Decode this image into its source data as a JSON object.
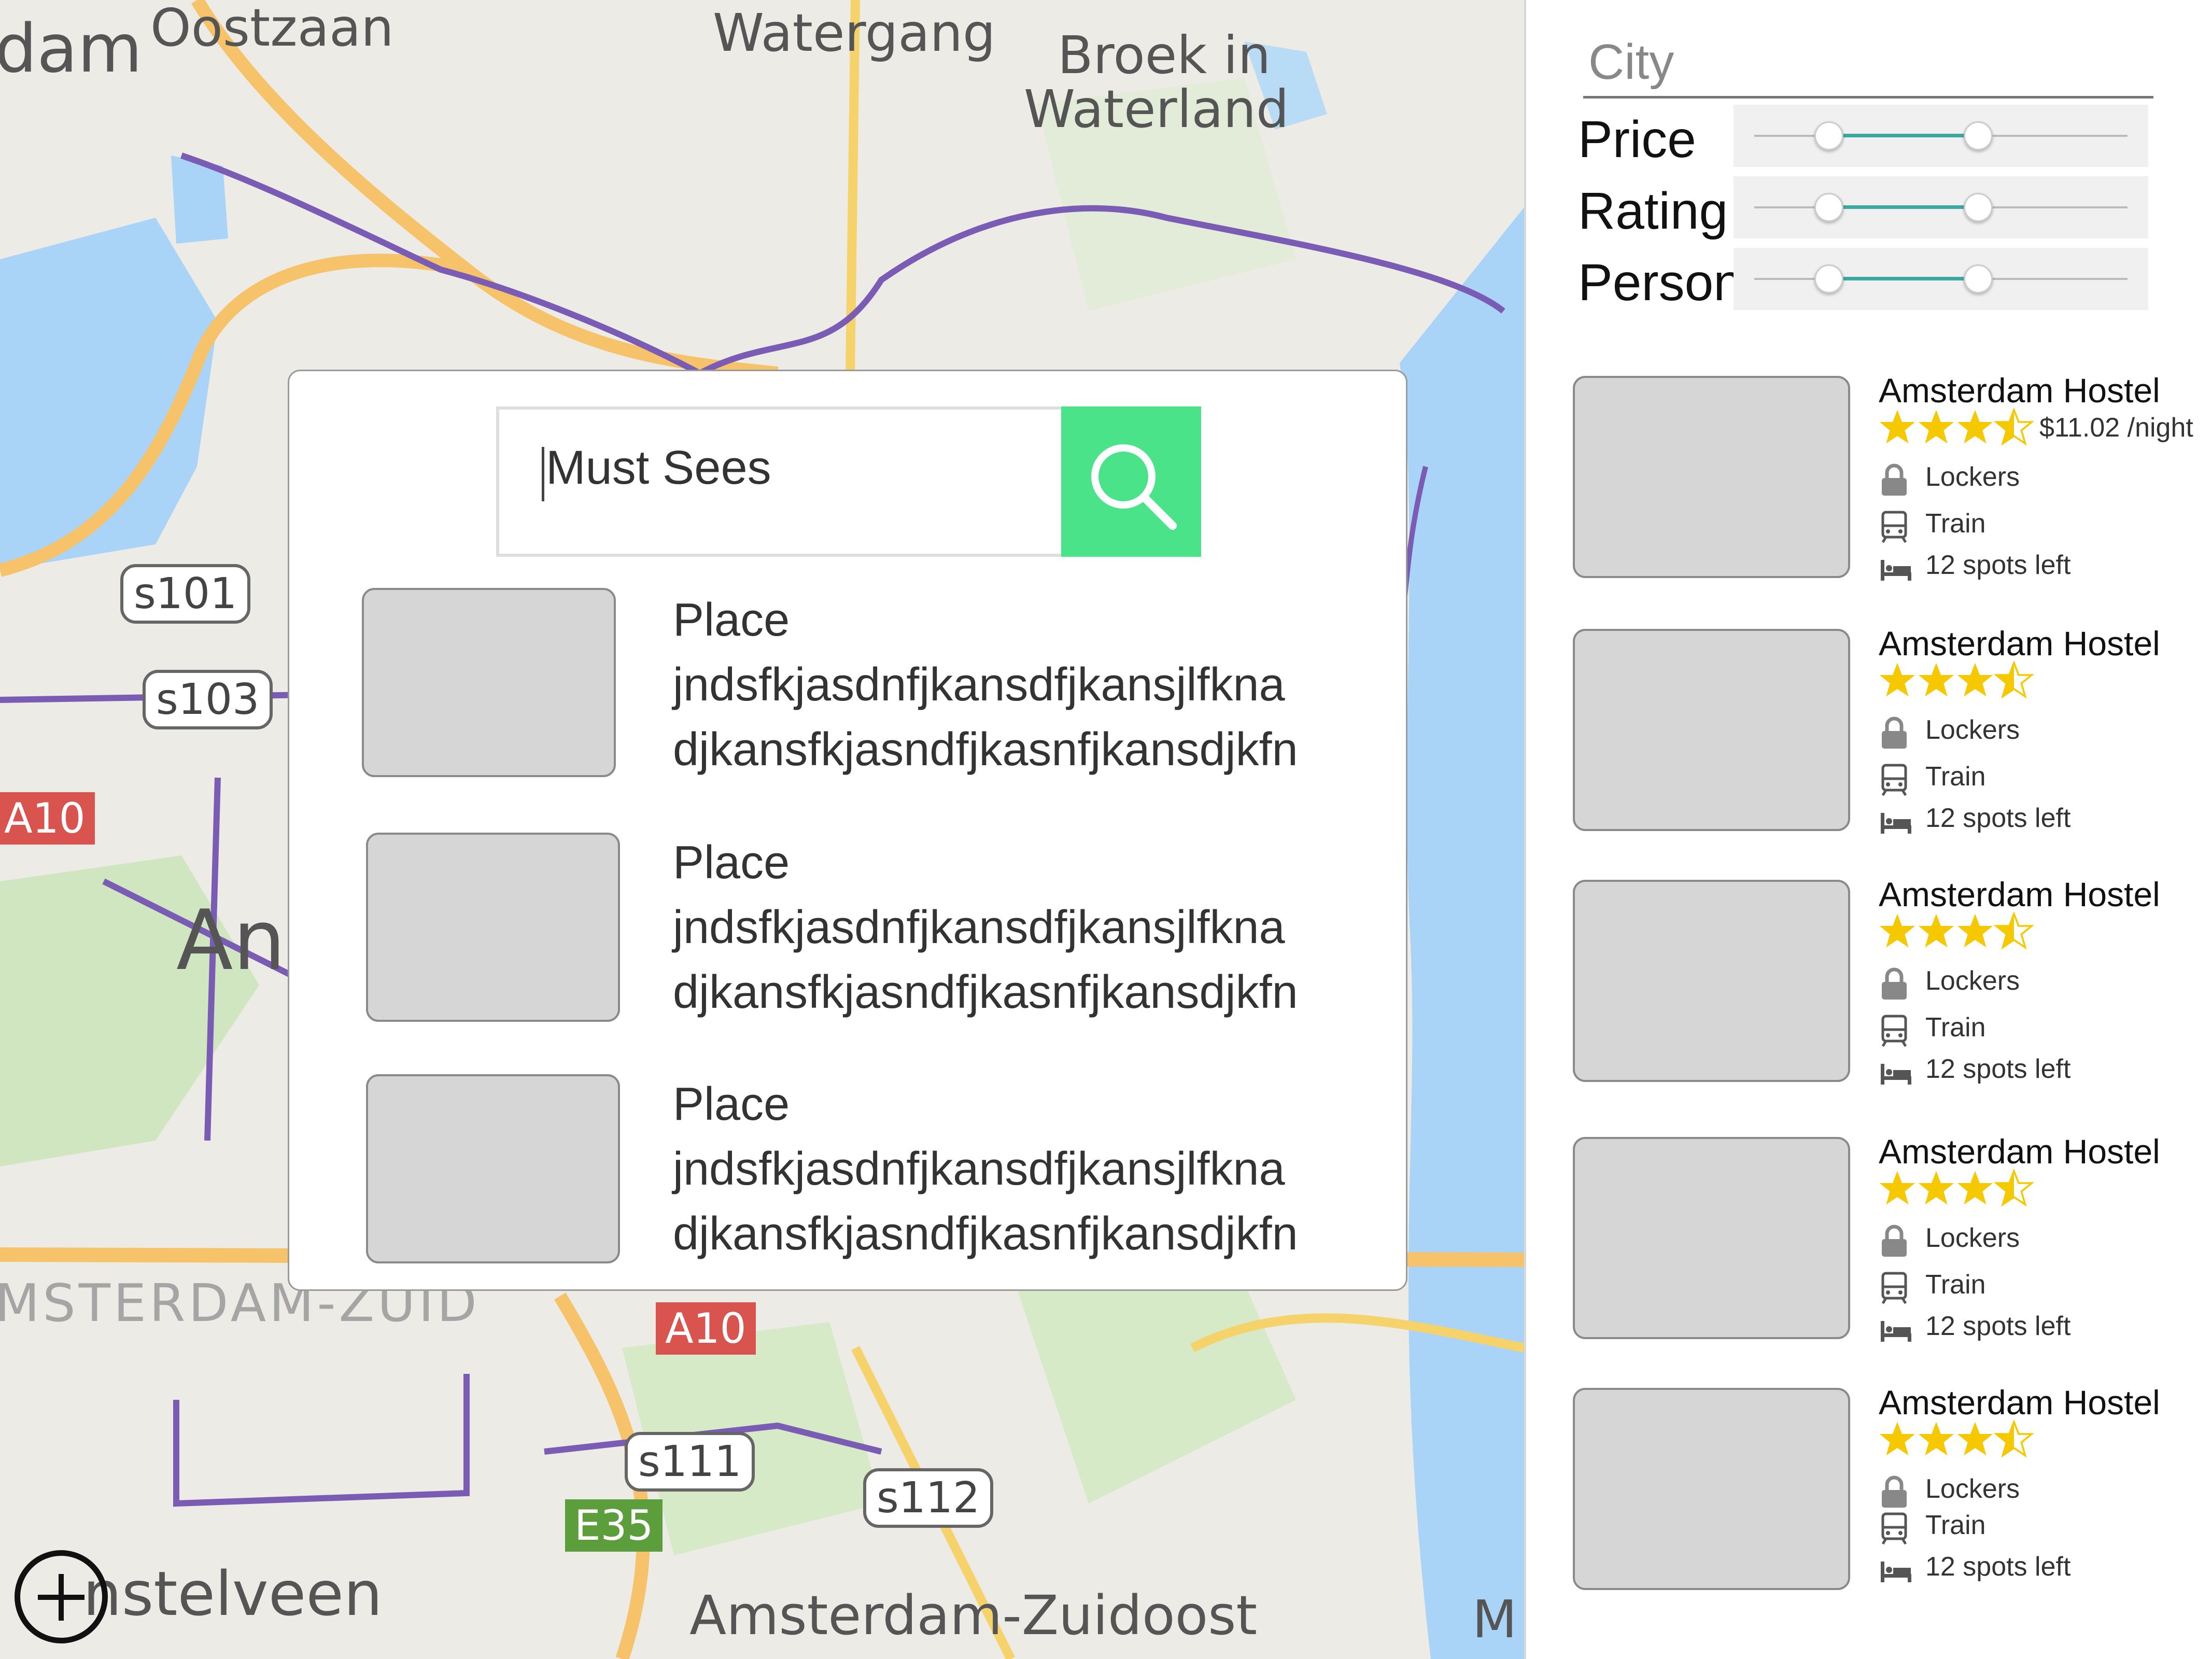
{
  "map": {
    "labels": [
      "dam",
      "Oostzaan",
      "Watergang",
      "Broek in",
      "Waterland",
      "An",
      "MSTERDAM-ZUID",
      "nstelveen",
      "Amsterdam-Zuidoost",
      "M"
    ],
    "shields": [
      "s101",
      "s103",
      "s111",
      "s112"
    ],
    "road_badges": [
      "A10",
      "A10",
      "E35"
    ],
    "zoom_icon": "plus-circle-icon"
  },
  "modal": {
    "search": {
      "value": "Must Sees",
      "button_icon": "search-icon",
      "button_color": "#4ae38a"
    },
    "places": [
      {
        "title": "Place",
        "line1": "jndsfkjasdnfjkansdfjkansjlfkna",
        "line2": "djkansfkjasndfjkasnfjkansdjkfn"
      },
      {
        "title": "Place",
        "line1": "jndsfkjasdnfjkansdfjkansjlfkna",
        "line2": "djkansfkjasndfjkasnfjkansdjkfn"
      },
      {
        "title": "Place",
        "line1": "jndsfkjasdnfjkansdfjkansjlfkna",
        "line2": "djkansfkjasndfjkasnfjkansdjkfn"
      }
    ]
  },
  "sidebar": {
    "city_placeholder": "City",
    "filters": [
      {
        "label": "Price",
        "range": [
          0.2,
          0.6
        ]
      },
      {
        "label": "Rating",
        "range": [
          0.2,
          0.6
        ]
      },
      {
        "label": "Person",
        "range": [
          0.2,
          0.6
        ]
      }
    ],
    "accent_color": "#3aa9a0",
    "star_color": "#f5c800",
    "hostels": [
      {
        "name": "Amsterdam Hostel",
        "rating": 3.5,
        "price": "$11.02 /night",
        "amenities": [
          "Lockers",
          "Train",
          "12 spots left"
        ]
      },
      {
        "name": "Amsterdam Hostel",
        "rating": 3.5,
        "price": "",
        "amenities": [
          "Lockers",
          "Train",
          "12 spots left"
        ]
      },
      {
        "name": "Amsterdam Hostel",
        "rating": 3.5,
        "price": "",
        "amenities": [
          "Lockers",
          "Train",
          "12 spots left"
        ]
      },
      {
        "name": "Amsterdam Hostel",
        "rating": 3.5,
        "price": "",
        "amenities": [
          "Lockers",
          "Train",
          "12 spots left"
        ]
      },
      {
        "name": "Amsterdam Hostel",
        "rating": 3.5,
        "price": "",
        "amenities": [
          "Lockers",
          "Train",
          "12 spots left"
        ]
      }
    ]
  }
}
